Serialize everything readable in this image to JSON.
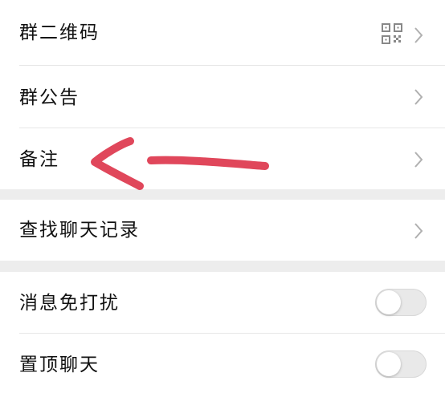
{
  "colors": {
    "background": "#ededed",
    "row_background": "#ffffff",
    "text": "#111111",
    "chevron": "#b0b0b0",
    "toggle_off": "#e9e9e9",
    "annotation_arrow": "#e0475b"
  },
  "settings": {
    "group_qr": {
      "label": "群二维码",
      "icon": "qr-code-icon"
    },
    "notice": {
      "label": "群公告"
    },
    "remark": {
      "label": "备注"
    },
    "search_history": {
      "label": "查找聊天记录"
    },
    "mute": {
      "label": "消息免打扰",
      "enabled": false
    },
    "pin_top": {
      "label": "置顶聊天",
      "enabled": false
    }
  },
  "annotation": {
    "icon": "red-arrow-left-icon"
  }
}
